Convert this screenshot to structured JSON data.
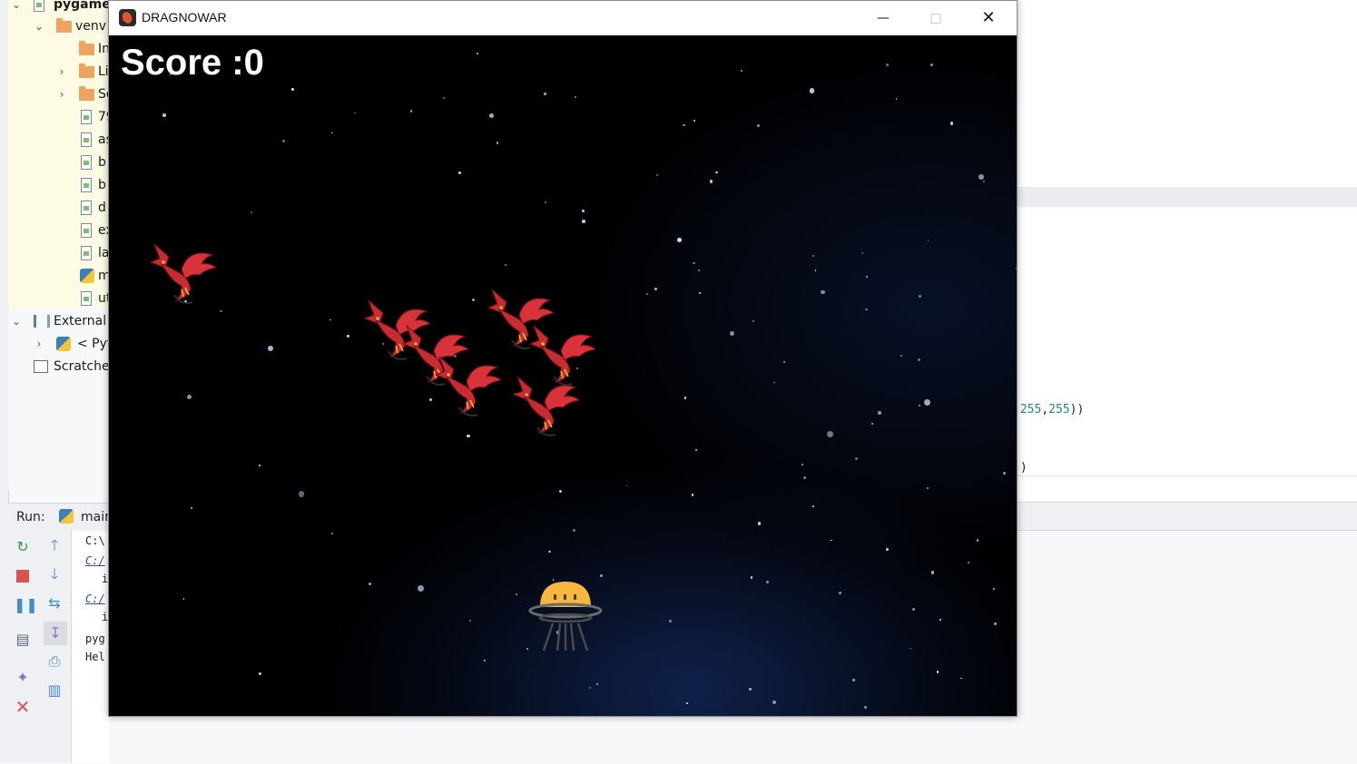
{
  "ide": {
    "project_tree": [
      {
        "label": "pygame",
        "type": "project",
        "bold": true
      },
      {
        "label": "venv",
        "type": "folder"
      },
      {
        "label": "In",
        "type": "folder"
      },
      {
        "label": "Li",
        "type": "folder"
      },
      {
        "label": "Sc",
        "type": "folder"
      },
      {
        "label": "79",
        "type": "image"
      },
      {
        "label": "as",
        "type": "image"
      },
      {
        "label": "b",
        "type": "unknown"
      },
      {
        "label": "b",
        "type": "image"
      },
      {
        "label": "d",
        "type": "image"
      },
      {
        "label": "ex",
        "type": "unknown"
      },
      {
        "label": "la",
        "type": "unknown"
      },
      {
        "label": "m",
        "type": "python"
      },
      {
        "label": "ut",
        "type": "image"
      },
      {
        "label": "External L",
        "type": "library"
      },
      {
        "label": "< Pyt",
        "type": "python"
      },
      {
        "label": "Scratches",
        "type": "scratch"
      }
    ],
    "run_label": "Run:",
    "run_tab": "main",
    "console_lines": [
      "C:\\",
      "C:/",
      "i",
      "C:/",
      "i",
      "pyg",
      "Hel"
    ],
    "code_fragment_1": {
      "prefix": ",",
      "n1": "255",
      "sep": ",",
      "n2": "255",
      "suffix": "))"
    },
    "code_fragment_2": "))"
  },
  "game_window": {
    "title": "DRAGNOWAR",
    "controls": {
      "minimize": "—",
      "maximize": "□",
      "close": "✕"
    },
    "score_text": "Score :0",
    "enemies": [
      {
        "type": "red-dragon",
        "count": 7
      }
    ],
    "player": {
      "type": "ufo-spaceship",
      "color": "#f6b73c"
    },
    "colors": {
      "dragon": "#d8323a",
      "sky": "#000000",
      "nebula": "#14305f"
    }
  }
}
